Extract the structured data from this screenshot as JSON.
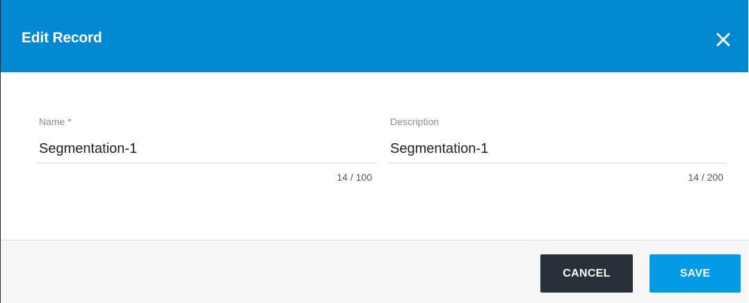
{
  "dialog": {
    "title": "Edit Record",
    "close_icon": "close-icon"
  },
  "form": {
    "name": {
      "label": "Name *",
      "value": "Segmentation-1",
      "counter": "14 / 100"
    },
    "description": {
      "label": "Description",
      "value": "Segmentation-1",
      "counter": "14 / 200"
    }
  },
  "footer": {
    "cancel_label": "CANCEL",
    "save_label": "SAVE"
  },
  "colors": {
    "header": "#0288d1",
    "cancel_button": "#283039",
    "save_button": "#039be5"
  }
}
